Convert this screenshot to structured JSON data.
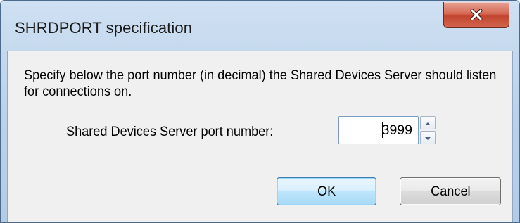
{
  "window": {
    "title": "SHRDPORT specification"
  },
  "dialog": {
    "description": "Specify below the port number (in decimal) the Shared Devices Server should listen for connections on.",
    "port_label": "Shared Devices Server port number:",
    "port_value": "3999"
  },
  "buttons": {
    "ok_label": "OK",
    "cancel_label": "Cancel"
  },
  "icons": {
    "close": "close-icon",
    "spin_up": "arrow-up-icon",
    "spin_down": "arrow-down-icon"
  },
  "colors": {
    "close_button": "#c2452e",
    "ok_border": "#3c7fb1",
    "frame": "#bcd3ea"
  }
}
